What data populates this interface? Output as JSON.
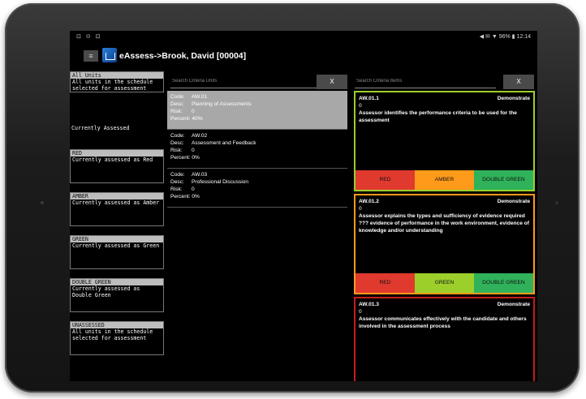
{
  "statusbar": {
    "left_icons": "⊡ ⊙ ⊡",
    "right": "◀ ✉ ▼ 96% ▮ 12:14"
  },
  "app": {
    "title": "eAssess->Brook, David [00004]",
    "menu_label": "≡"
  },
  "left": {
    "all_units": {
      "header": "All Units",
      "text": "All units in the schedule selected for assessment"
    },
    "currently_assessed": "Currently Assessed",
    "statuses": [
      {
        "header": "RED",
        "text": "Currently assessed as Red"
      },
      {
        "header": "AMBER",
        "text": "Currently assessed as Amber"
      },
      {
        "header": "GREEN",
        "text": "Currently assessed as Green"
      },
      {
        "header": "DOUBLE GREEN",
        "text": "Currently assessed as Double Green"
      },
      {
        "header": "UNASSESSED",
        "text": "All units in the schedule selected for assessment"
      }
    ]
  },
  "middle": {
    "search_placeholder": "Search Criteria Units",
    "clear_label": "X",
    "units": [
      {
        "code_label": "Code:",
        "code": "AW.01",
        "desc_label": "Desc:",
        "desc": "Planning of Assessments",
        "risk_label": "Risk:",
        "risk": "0",
        "percent": "Percent: 40%"
      },
      {
        "code_label": "Code:",
        "code": "AW.02",
        "desc_label": "Desc:",
        "desc": "Assessment and Feedback",
        "risk_label": "Risk:",
        "risk": "0",
        "percent": "Percent: 0%"
      },
      {
        "code_label": "Code:",
        "code": "AW.03",
        "desc_label": "Desc:",
        "desc": "Professional Discussion",
        "risk_label": "Risk:",
        "risk": "0",
        "percent": "Percent: 0%"
      }
    ]
  },
  "right": {
    "search_placeholder": "Search Criteria Items",
    "clear_label": "X",
    "items": [
      {
        "id": "AW.01.1",
        "type": "Demonstrate",
        "num": "0",
        "desc": "Assessor identifies the performance criteria to be used for the assessment",
        "btns": [
          "RED",
          "AMBER",
          "DOUBLE GREEN"
        ]
      },
      {
        "id": "AW.01.2",
        "type": "Demonstrate",
        "num": "0",
        "desc": "Assessor explains the types and sufficiency of evidence required ??? evidence of performance in the work environment, evidence of knowledge and/or understanding",
        "btns": [
          "RED",
          "GREEN",
          "DOUBLE GREEN"
        ]
      },
      {
        "id": "AW.01.3",
        "type": "Demonstrate",
        "num": "0",
        "desc": "Assessor communicates effectively with the candidate and others involved in the assessment process",
        "btns": []
      }
    ]
  },
  "colors": {
    "red": "#e03a2f",
    "amber": "#ff9a1a",
    "green": "#9ccf2a",
    "double_green": "#2fb25a"
  }
}
